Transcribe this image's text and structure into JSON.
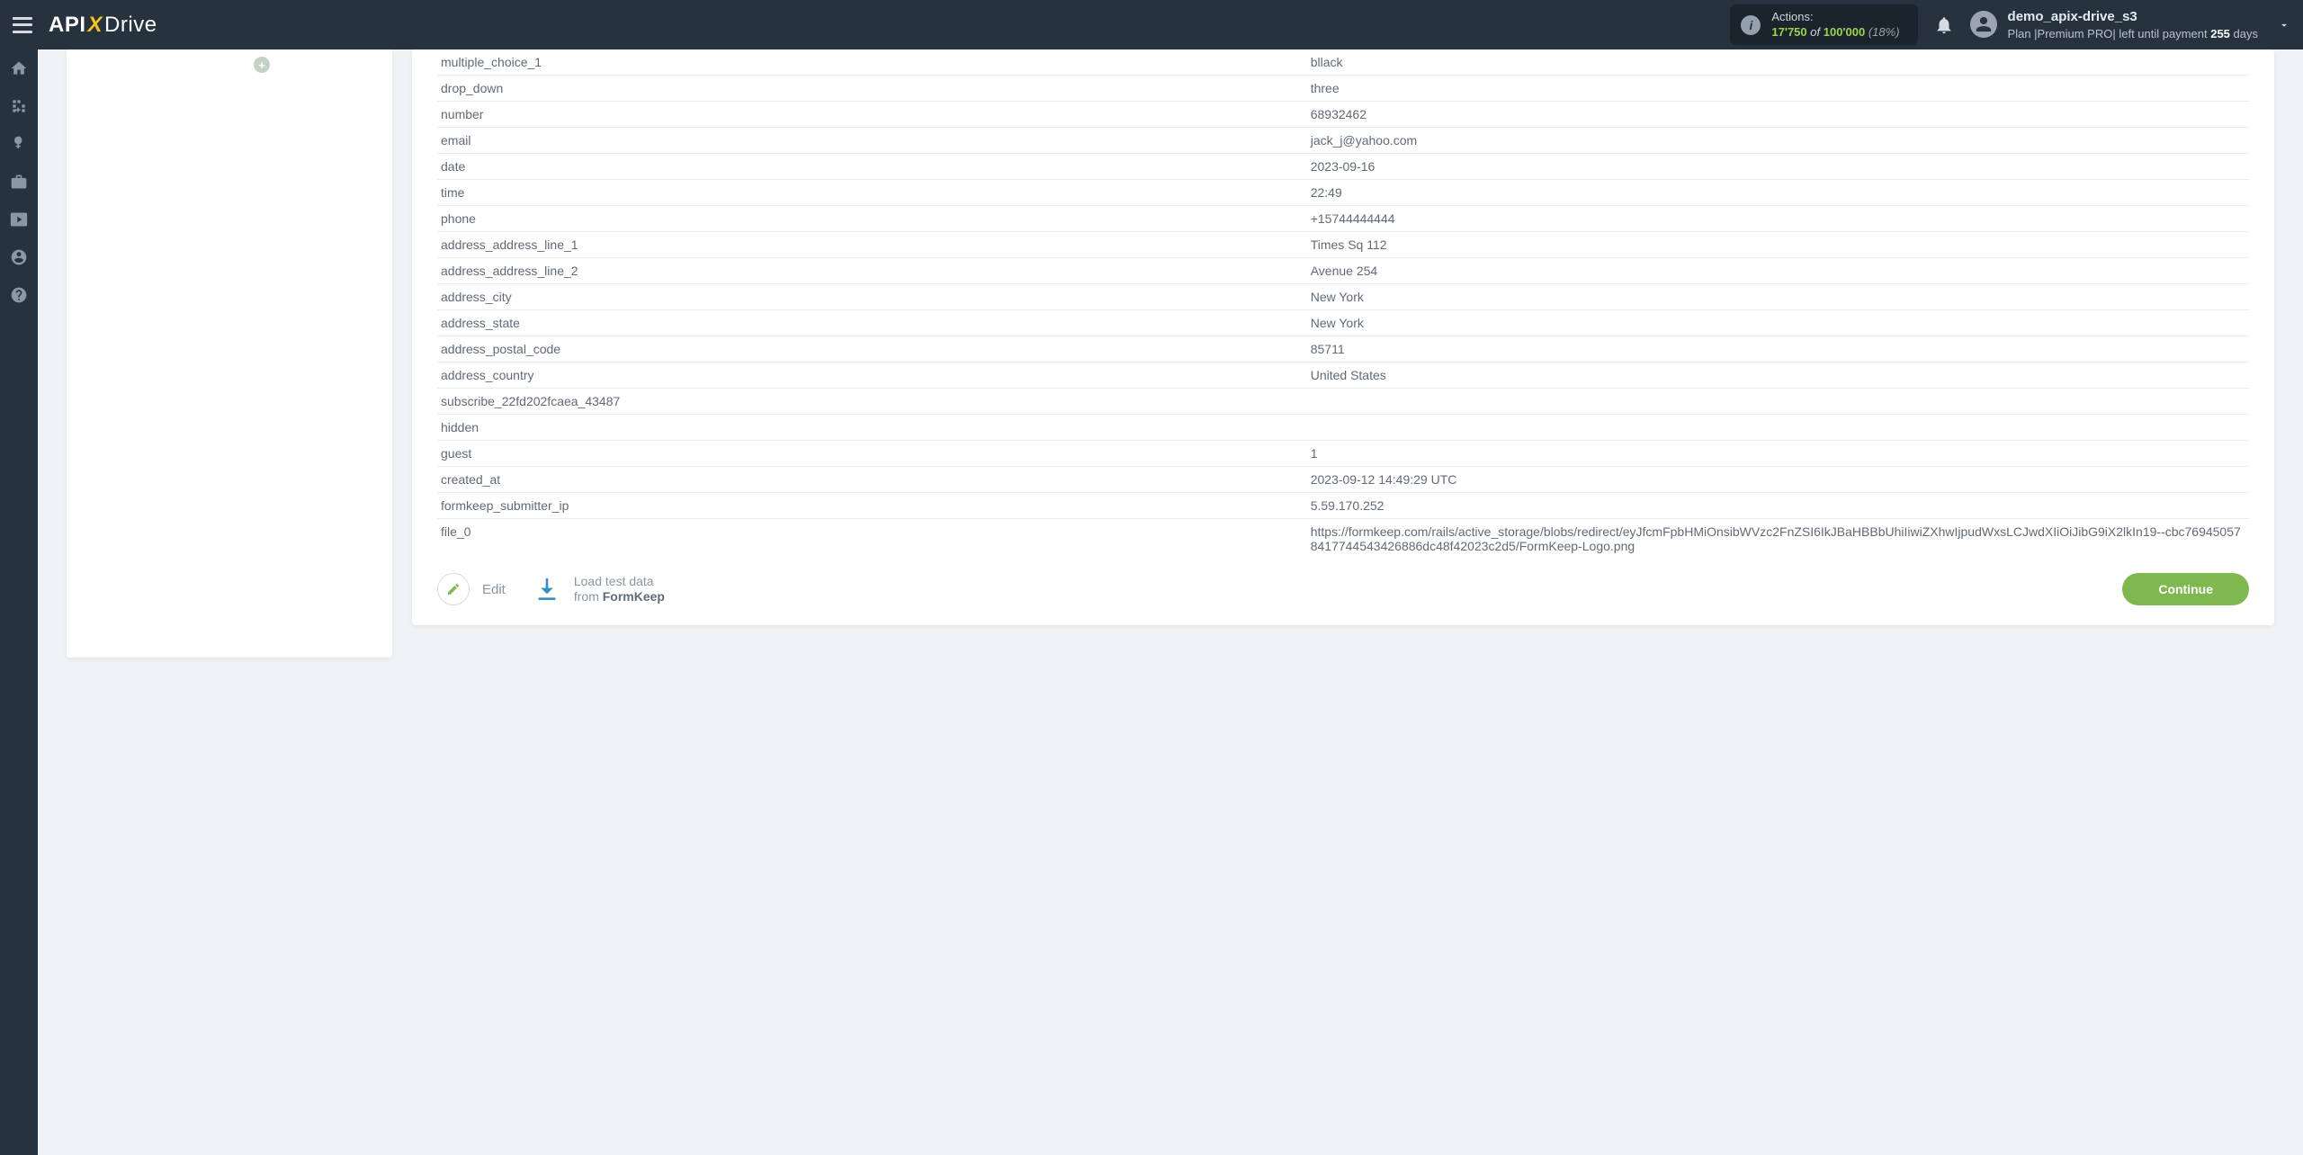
{
  "header": {
    "logo_api": "API",
    "logo_x": "X",
    "logo_drive": "Drive",
    "actions_label": "Actions:",
    "actions_used": "17'750",
    "actions_of": "of",
    "actions_total": "100'000",
    "actions_pct": "(18%)",
    "user_name": "demo_apix-drive_s3",
    "plan_prefix": "Plan |",
    "plan_name": "Premium PRO",
    "plan_mid": "| left until payment ",
    "plan_days": "255",
    "plan_days_suffix": " days"
  },
  "sidepanel": {
    "plus": "+"
  },
  "table": {
    "rows": [
      {
        "k": "multiple_choice_1",
        "v": "bllack"
      },
      {
        "k": "drop_down",
        "v": "three"
      },
      {
        "k": "number",
        "v": "68932462"
      },
      {
        "k": "email",
        "v": "jack_j@yahoo.com"
      },
      {
        "k": "date",
        "v": "2023-09-16"
      },
      {
        "k": "time",
        "v": "22:49"
      },
      {
        "k": "phone",
        "v": "+15744444444"
      },
      {
        "k": "address_address_line_1",
        "v": "Times Sq 112"
      },
      {
        "k": "address_address_line_2",
        "v": "Avenue 254"
      },
      {
        "k": "address_city",
        "v": "New York"
      },
      {
        "k": "address_state",
        "v": "New York"
      },
      {
        "k": "address_postal_code",
        "v": "85711"
      },
      {
        "k": "address_country",
        "v": "United States"
      },
      {
        "k": "subscribe_22fd202fcaea_43487",
        "v": ""
      },
      {
        "k": "hidden",
        "v": ""
      },
      {
        "k": "guest",
        "v": "1"
      },
      {
        "k": "created_at",
        "v": "2023-09-12 14:49:29 UTC"
      },
      {
        "k": "formkeep_submitter_ip",
        "v": "5.59.170.252"
      },
      {
        "k": "file_0",
        "v": "https://formkeep.com/rails/active_storage/blobs/redirect/eyJfcmFpbHMiOnsibWVzc2FnZSI6IkJBaHBBbUhiIiwiZXhwIjpudWxsLCJwdXIiOiJibG9iX2lkIn19--cbc769450578417744543426886dc48f42023c2d5/FormKeep-Logo.png"
      }
    ]
  },
  "footer": {
    "edit": "Edit",
    "load_line1": "Load test data",
    "load_line2_pre": "from ",
    "load_line2_b": "FormKeep",
    "continue": "Continue"
  }
}
